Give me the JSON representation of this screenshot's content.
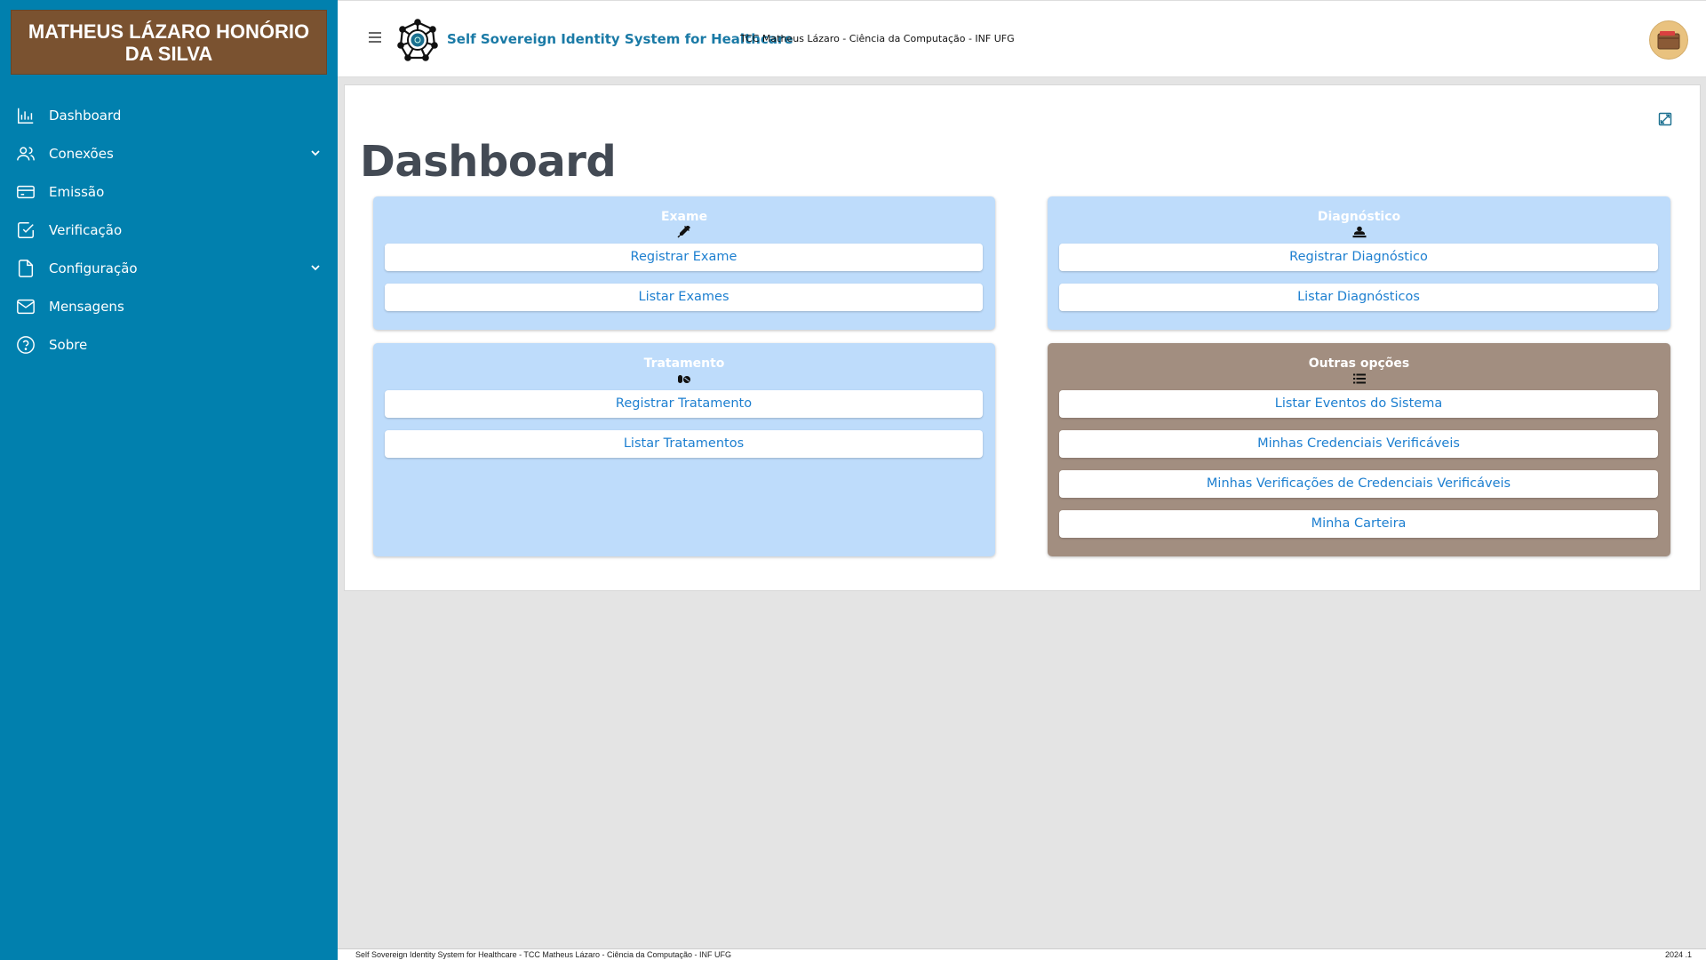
{
  "user": {
    "name": "MATHEUS LÁZARO HONÓRIO DA SILVA"
  },
  "sidebar": {
    "items": [
      {
        "label": "Dashboard"
      },
      {
        "label": "Conexões"
      },
      {
        "label": "Emissão"
      },
      {
        "label": "Verificação"
      },
      {
        "label": "Configuração"
      },
      {
        "label": "Mensagens"
      },
      {
        "label": "Sobre"
      }
    ]
  },
  "header": {
    "title": "Self Sovereign Identity System for Healthcare",
    "subtitle": "TCC Matheus Lázaro - Ciência da Computação - INF UFG"
  },
  "main": {
    "title": "Dashboard",
    "cards": {
      "exame": {
        "title": "Exame",
        "icon": "syringe-icon",
        "buttons": [
          "Registrar Exame",
          "Listar Exames"
        ]
      },
      "diagnostico": {
        "title": "Diagnóstico",
        "icon": "user-injured-icon",
        "buttons": [
          "Registrar Diagnóstico",
          "Listar Diagnósticos"
        ]
      },
      "tratamento": {
        "title": "Tratamento",
        "icon": "pills-icon",
        "buttons": [
          "Registrar Tratamento",
          "Listar Tratamentos"
        ]
      },
      "outras": {
        "title": "Outras opções",
        "icon": "list-icon",
        "buttons": [
          "Listar Eventos do Sistema",
          "Minhas Credenciais Verificáveis",
          "Minhas Verificações de Credenciais Verificáveis",
          "Minha Carteira"
        ]
      }
    }
  },
  "footer": {
    "left": "Self Sovereign Identity System for Healthcare - TCC Matheus Lázaro - Ciência da Computação - INF UFG",
    "right": "2024 .1"
  },
  "colors": {
    "sidebar": "#0180ae",
    "user_box": "#7a5230",
    "card_blue": "#bedcfb",
    "card_brown": "#a28e80",
    "link": "#1d7fd0"
  }
}
